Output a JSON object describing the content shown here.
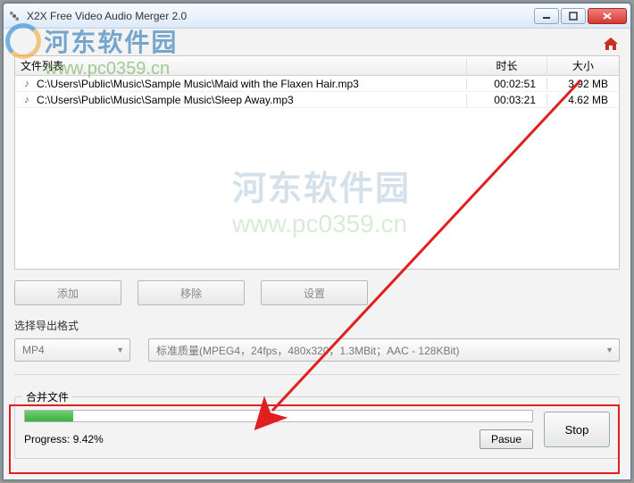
{
  "window": {
    "title": "X2X Free Video Audio Merger 2.0"
  },
  "list": {
    "header_file": "文件列表",
    "header_duration": "时长",
    "header_size": "大小",
    "rows": [
      {
        "path": "C:\\Users\\Public\\Music\\Sample Music\\Maid with the Flaxen Hair.mp3",
        "duration": "00:02:51",
        "size": "3.92 MB"
      },
      {
        "path": "C:\\Users\\Public\\Music\\Sample Music\\Sleep Away.mp3",
        "duration": "00:03:21",
        "size": "4.62 MB"
      }
    ]
  },
  "buttons": {
    "add": "添加",
    "remove": "移除",
    "settings": "设置",
    "pause": "Pasue",
    "stop": "Stop"
  },
  "format": {
    "section_label": "选择导出格式",
    "container": "MP4",
    "quality": "标准质量(MPEG4，24fps，480x320，1.3MBit；AAC - 128KBit)"
  },
  "progress": {
    "group_label": "合并文件",
    "label": "Progress:",
    "percent_text": "9.42%",
    "percent_value": 9.42
  },
  "watermark": {
    "site_cn": "河东软件园",
    "site_url": "www.pc0359.cn"
  }
}
